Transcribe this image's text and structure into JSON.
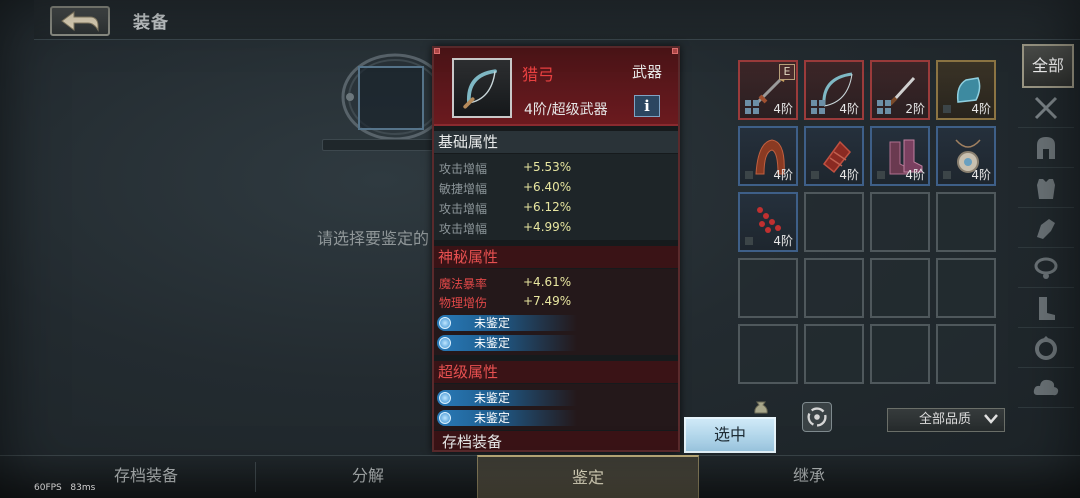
{
  "header": {
    "title": "装备"
  },
  "left": {
    "prompt": "请选择要鉴定的"
  },
  "tooltip": {
    "name": "猎弓",
    "type": "武器",
    "tier": "4阶/超级武器",
    "info_label": "i",
    "basic": {
      "title": "基础属性",
      "stats": [
        {
          "name": "攻击增幅",
          "value": "+5.53%"
        },
        {
          "name": "敏捷增幅",
          "value": "+6.40%"
        },
        {
          "name": "攻击增幅",
          "value": "+6.12%"
        },
        {
          "name": "攻击增幅",
          "value": "+4.99%"
        }
      ]
    },
    "mystic": {
      "title": "神秘属性",
      "stats": [
        {
          "name": "魔法暴率",
          "value": "+4.61%"
        },
        {
          "name": "物理增伤",
          "value": "+7.49%"
        }
      ],
      "unidentified": [
        "未鉴定",
        "未鉴定"
      ]
    },
    "super": {
      "title": "超级属性",
      "unidentified": [
        "未鉴定",
        "未鉴定"
      ]
    },
    "archive": "存档装备"
  },
  "select_button": "选中",
  "inventory": [
    {
      "tier": "4阶",
      "badge": "E"
    },
    {
      "tier": "4阶"
    },
    {
      "tier": "2阶"
    },
    {
      "tier": "4阶"
    },
    {
      "tier": "4阶"
    },
    {
      "tier": "4阶"
    },
    {
      "tier": "4阶"
    },
    {
      "tier": "4阶"
    },
    {
      "tier": "4阶"
    }
  ],
  "categories": {
    "all": "全部"
  },
  "quality_filter": "全部品质",
  "tabs": [
    "存档装备",
    "分解",
    "鉴定",
    "继承"
  ],
  "active_tab": "鉴定",
  "debug": {
    "fps": "60FPS",
    "ms": "83ms"
  },
  "colors": {
    "accent_red": "#e84040",
    "select_blue": "#9cc8e2",
    "stat_value": "#e8e6a0"
  }
}
